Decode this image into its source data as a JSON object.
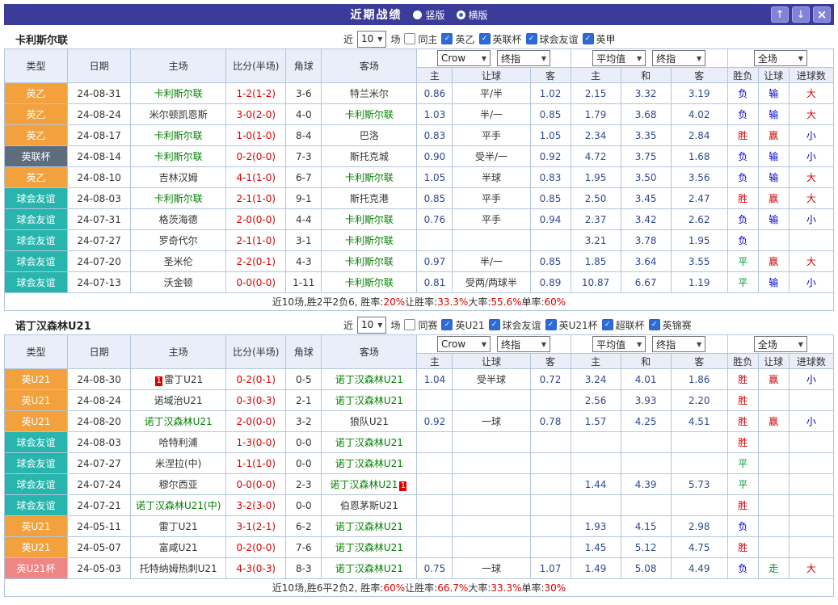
{
  "topbar": {
    "title": "近期战绩",
    "radios": [
      {
        "label": "竖版",
        "checked": false
      },
      {
        "label": "横版",
        "checked": true
      }
    ],
    "buttons": {
      "up": "↑",
      "down": "↓",
      "close": "×"
    }
  },
  "result_color_map": {
    "胜": "red",
    "负": "blue",
    "平": "green",
    "赢": "red",
    "输": "blue",
    "走": "green",
    "大": "red",
    "小": "blue"
  },
  "type_style_map": {
    "英乙": "orange",
    "英联杯": "slate",
    "球会友谊": "teal",
    "英U21": "orange",
    "英U21杯": "pink"
  },
  "colors": {
    "titlebar": "#3b3b9a",
    "badge_orange": "#f2a13c",
    "badge_slate": "#5e6d7d",
    "badge_teal": "#27b5ad",
    "badge_pink": "#ef8585",
    "win_red": "#d40000",
    "lose_blue": "#0000cc",
    "draw_green": "#009933",
    "main_team_green": "#008000"
  },
  "sections": [
    {
      "team": "卡利斯尔联",
      "filters": {
        "near": "近",
        "count": "10",
        "games": "场",
        "same": "同主",
        "same_checked": false,
        "leagues": [
          {
            "label": "英乙",
            "checked": true
          },
          {
            "label": "英联杯",
            "checked": true
          },
          {
            "label": "球会友谊",
            "checked": true
          },
          {
            "label": "英甲",
            "checked": true
          }
        ]
      },
      "dropdowns": {
        "odds_source": "Crow",
        "odds_kind": "终指",
        "avg_source": "平均值",
        "avg_kind": "终指",
        "scope": "全场"
      },
      "columns": [
        "类型",
        "日期",
        "主场",
        "比分(半场)",
        "角球",
        "客场"
      ],
      "odds_cols": [
        "主",
        "让球",
        "客"
      ],
      "avg_cols": [
        "主",
        "和",
        "客"
      ],
      "result_cols": [
        "胜负",
        "让球",
        "进球数"
      ],
      "rows": [
        {
          "type": "英乙",
          "date": "24-08-31",
          "home": "卡利斯尔联",
          "home_main": true,
          "score": "1-2(1-2)",
          "corner": "3-6",
          "away": "特兰米尔",
          "away_main": false,
          "odds": [
            "0.86",
            "平/半",
            "1.02"
          ],
          "avg": [
            "2.15",
            "3.32",
            "3.19"
          ],
          "results": [
            "负",
            "输",
            "大"
          ]
        },
        {
          "type": "英乙",
          "date": "24-08-24",
          "home": "米尔顿凯恩斯",
          "home_main": false,
          "score": "3-0(2-0)",
          "corner": "4-0",
          "away": "卡利斯尔联",
          "away_main": true,
          "odds": [
            "1.03",
            "半/一",
            "0.85"
          ],
          "avg": [
            "1.79",
            "3.68",
            "4.02"
          ],
          "results": [
            "负",
            "输",
            "大"
          ]
        },
        {
          "type": "英乙",
          "date": "24-08-17",
          "home": "卡利斯尔联",
          "home_main": true,
          "score": "1-0(1-0)",
          "corner": "8-4",
          "away": "巴洛",
          "away_main": false,
          "odds": [
            "0.83",
            "平手",
            "1.05"
          ],
          "avg": [
            "2.34",
            "3.35",
            "2.84"
          ],
          "results": [
            "胜",
            "赢",
            "小"
          ]
        },
        {
          "type": "英联杯",
          "date": "24-08-14",
          "home": "卡利斯尔联",
          "home_main": true,
          "score": "0-2(0-0)",
          "corner": "7-3",
          "away": "斯托克城",
          "away_main": false,
          "odds": [
            "0.90",
            "受半/一",
            "0.92"
          ],
          "avg": [
            "4.72",
            "3.75",
            "1.68"
          ],
          "results": [
            "负",
            "输",
            "小"
          ]
        },
        {
          "type": "英乙",
          "date": "24-08-10",
          "home": "吉林汉姆",
          "home_main": false,
          "score": "4-1(1-0)",
          "corner": "6-7",
          "away": "卡利斯尔联",
          "away_main": true,
          "odds": [
            "1.05",
            "半球",
            "0.83"
          ],
          "avg": [
            "1.95",
            "3.50",
            "3.56"
          ],
          "results": [
            "负",
            "输",
            "大"
          ]
        },
        {
          "type": "球会友谊",
          "date": "24-08-03",
          "home": "卡利斯尔联",
          "home_main": true,
          "score": "2-1(1-0)",
          "corner": "9-1",
          "away": "斯托克港",
          "away_main": false,
          "odds": [
            "0.85",
            "平手",
            "0.85"
          ],
          "avg": [
            "2.50",
            "3.45",
            "2.47"
          ],
          "results": [
            "胜",
            "赢",
            "大"
          ]
        },
        {
          "type": "球会友谊",
          "date": "24-07-31",
          "home": "格茨海德",
          "home_main": false,
          "score": "2-0(0-0)",
          "corner": "4-4",
          "away": "卡利斯尔联",
          "away_main": true,
          "odds": [
            "0.76",
            "平手",
            "0.94"
          ],
          "avg": [
            "2.37",
            "3.42",
            "2.62"
          ],
          "results": [
            "负",
            "输",
            "小"
          ]
        },
        {
          "type": "球会友谊",
          "date": "24-07-27",
          "home": "罗奇代尔",
          "home_main": false,
          "score": "2-1(1-0)",
          "corner": "3-1",
          "away": "卡利斯尔联",
          "away_main": true,
          "odds": [
            "",
            "",
            ""
          ],
          "avg": [
            "3.21",
            "3.78",
            "1.95"
          ],
          "results": [
            "负",
            "",
            ""
          ]
        },
        {
          "type": "球会友谊",
          "date": "24-07-20",
          "home": "圣米伦",
          "home_main": false,
          "score": "2-2(0-1)",
          "corner": "4-3",
          "away": "卡利斯尔联",
          "away_main": true,
          "odds": [
            "0.97",
            "半/一",
            "0.85"
          ],
          "avg": [
            "1.85",
            "3.64",
            "3.55"
          ],
          "results": [
            "平",
            "赢",
            "大"
          ]
        },
        {
          "type": "球会友谊",
          "date": "24-07-13",
          "home": "沃金顿",
          "home_main": false,
          "score": "0-0(0-0)",
          "corner": "1-11",
          "away": "卡利斯尔联",
          "away_main": true,
          "odds": [
            "0.81",
            "受两/两球半",
            "0.89"
          ],
          "avg": [
            "10.87",
            "6.67",
            "1.19"
          ],
          "results": [
            "平",
            "输",
            "小"
          ]
        }
      ],
      "summary": [
        {
          "t": "近10场,胜2平2负6, 胜率:"
        },
        {
          "t": "20%",
          "red": true
        },
        {
          "t": " 让胜率:"
        },
        {
          "t": "33.3%",
          "red": true
        },
        {
          "t": " 大率:"
        },
        {
          "t": "55.6%",
          "red": true
        },
        {
          "t": " 单率:"
        },
        {
          "t": "60%",
          "red": true
        }
      ]
    },
    {
      "team": "诺丁汉森林U21",
      "filters": {
        "near": "近",
        "count": "10",
        "games": "场",
        "same": "同赛",
        "same_checked": false,
        "leagues": [
          {
            "label": "英U21",
            "checked": true
          },
          {
            "label": "球会友谊",
            "checked": true
          },
          {
            "label": "英U21杯",
            "checked": true
          },
          {
            "label": "超联杯",
            "checked": true
          },
          {
            "label": "英锦赛",
            "checked": true
          }
        ]
      },
      "dropdowns": {
        "odds_source": "Crow",
        "odds_kind": "终指",
        "avg_source": "平均值",
        "avg_kind": "终指",
        "scope": "全场"
      },
      "columns": [
        "类型",
        "日期",
        "主场",
        "比分(半场)",
        "角球",
        "客场"
      ],
      "odds_cols": [
        "主",
        "让球",
        "客"
      ],
      "avg_cols": [
        "主",
        "和",
        "客"
      ],
      "result_cols": [
        "胜负",
        "让球",
        "进球数"
      ],
      "rows": [
        {
          "type": "英U21",
          "date": "24-08-30",
          "home": "雷丁U21",
          "home_main": false,
          "home_card": "1",
          "score": "0-2(0-1)",
          "corner": "0-5",
          "away": "诺丁汉森林U21",
          "away_main": true,
          "odds": [
            "1.04",
            "受半球",
            "0.72"
          ],
          "avg": [
            "3.24",
            "4.01",
            "1.86"
          ],
          "results": [
            "胜",
            "赢",
            "小"
          ]
        },
        {
          "type": "英U21",
          "date": "24-08-24",
          "home": "诺域治U21",
          "home_main": false,
          "score": "0-3(0-3)",
          "corner": "2-1",
          "away": "诺丁汉森林U21",
          "away_main": true,
          "odds": [
            "",
            "",
            ""
          ],
          "avg": [
            "2.56",
            "3.93",
            "2.20"
          ],
          "results": [
            "胜",
            "",
            ""
          ]
        },
        {
          "type": "英U21",
          "date": "24-08-20",
          "home": "诺丁汉森林U21",
          "home_main": true,
          "score": "2-0(0-0)",
          "corner": "3-2",
          "away": "狼队U21",
          "away_main": false,
          "odds": [
            "0.92",
            "一球",
            "0.78"
          ],
          "avg": [
            "1.57",
            "4.25",
            "4.51"
          ],
          "results": [
            "胜",
            "赢",
            "小"
          ]
        },
        {
          "type": "球会友谊",
          "date": "24-08-03",
          "home": "哈特利浦",
          "home_main": false,
          "score": "1-3(0-0)",
          "corner": "0-0",
          "away": "诺丁汉森林U21",
          "away_main": true,
          "odds": [
            "",
            "",
            ""
          ],
          "avg": [
            "",
            "",
            ""
          ],
          "results": [
            "胜",
            "",
            ""
          ]
        },
        {
          "type": "球会友谊",
          "date": "24-07-27",
          "home": "米涅拉(中)",
          "home_main": false,
          "score": "1-1(1-0)",
          "corner": "0-0",
          "away": "诺丁汉森林U21",
          "away_main": true,
          "odds": [
            "",
            "",
            ""
          ],
          "avg": [
            "",
            "",
            ""
          ],
          "results": [
            "平",
            "",
            ""
          ]
        },
        {
          "type": "球会友谊",
          "date": "24-07-24",
          "home": "穆尔西亚",
          "home_main": false,
          "score": "0-0(0-0)",
          "corner": "2-3",
          "away": "诺丁汉森林U21",
          "away_main": true,
          "away_card": "1",
          "odds": [
            "",
            "",
            ""
          ],
          "avg": [
            "1.44",
            "4.39",
            "5.73"
          ],
          "results": [
            "平",
            "",
            ""
          ]
        },
        {
          "type": "球会友谊",
          "date": "24-07-21",
          "home": "诺丁汉森林U21(中)",
          "home_main": true,
          "score": "3-2(3-0)",
          "corner": "0-0",
          "away": "伯恩茅斯U21",
          "away_main": false,
          "odds": [
            "",
            "",
            ""
          ],
          "avg": [
            "",
            "",
            ""
          ],
          "results": [
            "胜",
            "",
            ""
          ]
        },
        {
          "type": "英U21",
          "date": "24-05-11",
          "home": "雷丁U21",
          "home_main": false,
          "score": "3-1(2-1)",
          "corner": "6-2",
          "away": "诺丁汉森林U21",
          "away_main": true,
          "odds": [
            "",
            "",
            ""
          ],
          "avg": [
            "1.93",
            "4.15",
            "2.98"
          ],
          "results": [
            "负",
            "",
            ""
          ]
        },
        {
          "type": "英U21",
          "date": "24-05-07",
          "home": "富咸U21",
          "home_main": false,
          "score": "0-2(0-0)",
          "corner": "7-6",
          "away": "诺丁汉森林U21",
          "away_main": true,
          "odds": [
            "",
            "",
            ""
          ],
          "avg": [
            "1.45",
            "5.12",
            "4.75"
          ],
          "results": [
            "胜",
            "",
            ""
          ]
        },
        {
          "type": "英U21杯",
          "date": "24-05-03",
          "home": "托特纳姆热刺U21",
          "home_main": false,
          "score": "4-3(0-3)",
          "corner": "8-3",
          "away": "诺丁汉森林U21",
          "away_main": true,
          "odds": [
            "0.75",
            "一球",
            "1.07"
          ],
          "avg": [
            "1.49",
            "5.08",
            "4.49"
          ],
          "results": [
            "负",
            "走",
            "大"
          ]
        }
      ],
      "summary": [
        {
          "t": "近10场,胜6平2负2, 胜率:"
        },
        {
          "t": "60%",
          "red": true
        },
        {
          "t": " 让胜率:"
        },
        {
          "t": "66.7%",
          "red": true
        },
        {
          "t": " 大率:"
        },
        {
          "t": "33.3%",
          "red": true
        },
        {
          "t": " 单率:"
        },
        {
          "t": "30%",
          "red": true
        }
      ]
    }
  ]
}
